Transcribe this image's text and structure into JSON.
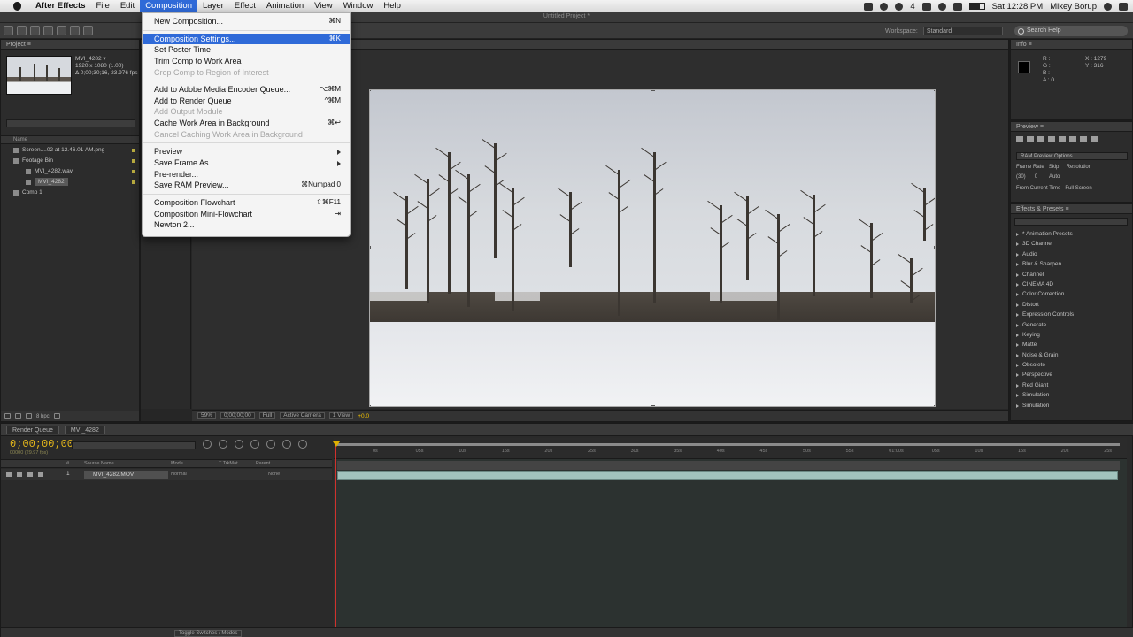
{
  "menubar": {
    "app": "After Effects",
    "items": [
      "File",
      "Edit",
      "Composition",
      "Layer",
      "Effect",
      "Animation",
      "View",
      "Window",
      "Help"
    ],
    "active_index": 2,
    "clock": "Sat 12:28 PM",
    "user": "Mikey Borup",
    "battery": "4"
  },
  "app_title": "Untitled Project *",
  "toolbar": {
    "workspace_label": "Workspace:",
    "workspace_value": "Standard",
    "search_placeholder": "Search Help"
  },
  "project": {
    "tab": "Project ≡",
    "clip_name": "MVI_4282 ▾",
    "clip_info_1": "1920 x 1080 (1.00)",
    "clip_info_2": "Δ 0;00;30;16, 23.976 fps",
    "header": "Name",
    "items": [
      {
        "label": "Screen....02 at 12.46.01 AM.png",
        "sub": false,
        "selected": false
      },
      {
        "label": "Footage Bin",
        "sub": false,
        "selected": false
      },
      {
        "label": "MVI_4282.wav",
        "sub": true,
        "selected": false
      },
      {
        "label": "MVI_4282",
        "sub": true,
        "selected": false
      },
      {
        "label": "Comp 1",
        "sub": false,
        "selected": false
      }
    ],
    "bpc": "8 bpc"
  },
  "viewer": {
    "zoom": "59%",
    "timecode": "0;00;00;00",
    "resolution": "Full",
    "camera": "Active Camera",
    "views": "1 View",
    "exposure": "+0.0"
  },
  "info": {
    "tab": "Info ≡",
    "r": "R :",
    "g": "G :",
    "b": "B :",
    "a": "A : 0",
    "x": "X : 1279",
    "y": "Y : 316"
  },
  "preview": {
    "tab": "Preview ≡",
    "ram_options": "RAM Preview Options",
    "frame_rate_label": "Frame Rate",
    "skip_label": "Skip",
    "resolution_label": "Resolution",
    "frame_rate_value": "(30)",
    "skip_value": "0",
    "resolution_value": "Auto",
    "from_current": "From Current Time",
    "full_screen": "Full Screen"
  },
  "effects": {
    "tab": "Effects & Presets ≡",
    "items": [
      "* Animation Presets",
      "3D Channel",
      "Audio",
      "Blur & Sharpen",
      "Channel",
      "CINEMA 4D",
      "Color Correction",
      "Distort",
      "Expression Controls",
      "Generate",
      "Keying",
      "Matte",
      "Noise & Grain",
      "Obsolete",
      "Perspective",
      "Red Giant",
      "Simulation",
      "Simulation"
    ]
  },
  "timeline": {
    "tabs": [
      "Render Queue",
      "MVI_4282"
    ],
    "time": "0;00;00;00",
    "fps": "00000 (29.97 fps)",
    "columns": [
      "#",
      "Source Name",
      "Mode",
      "T TrkMat",
      "Parent"
    ],
    "layer": {
      "index": "1",
      "name": "MVI_4282.MOV",
      "mode": "Normal",
      "parent": "None"
    },
    "ticks": [
      "0s",
      "05s",
      "10s",
      "15s",
      "20s",
      "25s",
      "30s",
      "35s",
      "40s",
      "45s",
      "50s",
      "55s",
      "01:00s",
      "05s",
      "10s",
      "15s",
      "20s",
      "25s",
      "30s"
    ],
    "toggle": "Toggle Switches / Modes"
  },
  "dropdown": {
    "items": [
      {
        "label": "New Composition...",
        "shortcut": "⌘N",
        "state": "normal",
        "sep_after": true
      },
      {
        "label": "Composition Settings...",
        "shortcut": "⌘K",
        "state": "highlight",
        "sep_after": false
      },
      {
        "label": "Set Poster Time",
        "shortcut": "",
        "state": "normal",
        "sep_after": false
      },
      {
        "label": "Trim Comp to Work Area",
        "shortcut": "",
        "state": "normal",
        "sep_after": false
      },
      {
        "label": "Crop Comp to Region of Interest",
        "shortcut": "",
        "state": "disabled",
        "sep_after": true
      },
      {
        "label": "Add to Adobe Media Encoder Queue...",
        "shortcut": "⌥⌘M",
        "state": "normal",
        "sep_after": false
      },
      {
        "label": "Add to Render Queue",
        "shortcut": "^⌘M",
        "state": "normal",
        "sep_after": false
      },
      {
        "label": "Add Output Module",
        "shortcut": "",
        "state": "disabled",
        "sep_after": false
      },
      {
        "label": "Cache Work Area in Background",
        "shortcut": "⌘↩",
        "state": "normal",
        "sep_after": false
      },
      {
        "label": "Cancel Caching Work Area in Background",
        "shortcut": "",
        "state": "disabled",
        "sep_after": true
      },
      {
        "label": "Preview",
        "shortcut": "",
        "state": "submenu",
        "sep_after": false
      },
      {
        "label": "Save Frame As",
        "shortcut": "",
        "state": "submenu",
        "sep_after": false
      },
      {
        "label": "Pre-render...",
        "shortcut": "",
        "state": "normal",
        "sep_after": false
      },
      {
        "label": "Save RAM Preview...",
        "shortcut": "⌘Numpad 0",
        "state": "normal",
        "sep_after": true
      },
      {
        "label": "Composition Flowchart",
        "shortcut": "⇧⌘F11",
        "state": "normal",
        "sep_after": false
      },
      {
        "label": "Composition Mini-Flowchart",
        "shortcut": "⇥",
        "state": "normal",
        "sep_after": false
      },
      {
        "label": "Newton 2...",
        "shortcut": "",
        "state": "normal",
        "sep_after": false
      }
    ]
  },
  "colors": {
    "accent": "#2f6ad8",
    "timecode": "#e3b61b",
    "playhead": "#d0312d",
    "layer_bar": "#a1c3bd"
  }
}
